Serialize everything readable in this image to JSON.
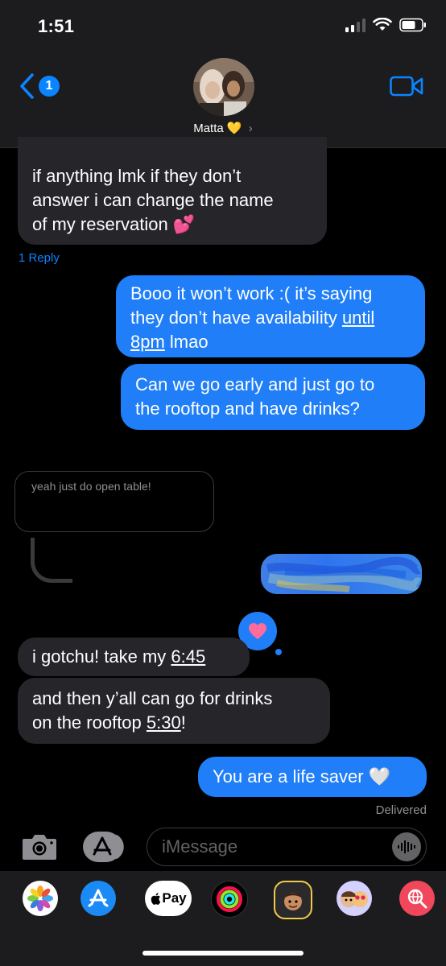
{
  "status": {
    "time": "1:51"
  },
  "nav": {
    "back_badge": "1",
    "contact_name": "Matta",
    "contact_emoji": "💛",
    "contact_chevron": "›"
  },
  "messages": {
    "m1_line1": "if anything lmk if they don’t",
    "m1_line2": "answer i can change the name",
    "m1_line3": "of my reservation 💕",
    "reply_link": "1 Reply",
    "m2_line1": "Booo it won’t work :( it’s saying",
    "m2_line2_a": "they don’t have availability ",
    "m2_line2_b": "until",
    "m2_line3_a": "8pm",
    "m2_line3_b": " lmao",
    "m3_line1": "Can we go early and just go to",
    "m3_line2": "the rooftop and have drinks?",
    "quoted": "yeah just do open table!",
    "m4_a": "i gotchu! take my ",
    "m4_b": "6:45",
    "m5_line1": "and then y’all can go for drinks",
    "m5_line2_a": "on the rooftop ",
    "m5_line2_b": "5:30",
    "m5_line2_c": "!",
    "m6": "You are a life saver 🤍",
    "delivered": "Delivered"
  },
  "composer": {
    "placeholder": "iMessage"
  },
  "tray": {
    "apple_pay": "Pay"
  },
  "colors": {
    "accent": "#0a84ff",
    "outgoing": "#1f7ef8",
    "incoming": "#26252a",
    "tapback_heart": "#ff6b9a"
  }
}
